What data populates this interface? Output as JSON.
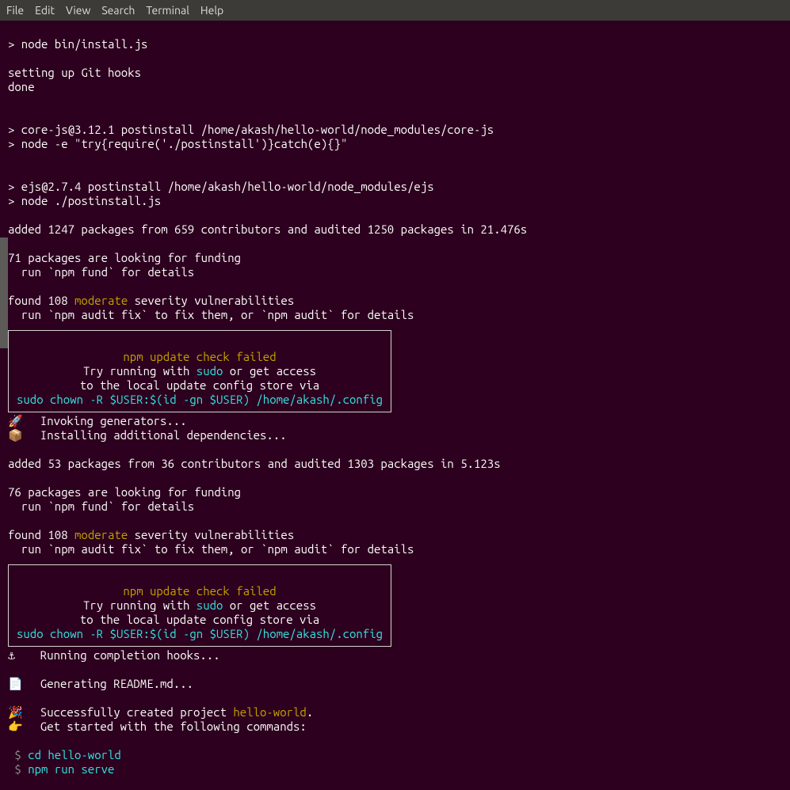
{
  "menu": {
    "file": "File",
    "edit": "Edit",
    "view": "View",
    "search": "Search",
    "terminal": "Terminal",
    "help": "Help"
  },
  "lines": {
    "l01": "> node bin/install.js",
    "l02": "",
    "l03": "setting up Git hooks",
    "l04": "done",
    "l05": "",
    "l06": "",
    "l07": "> core-js@3.12.1 postinstall /home/akash/hello-world/node_modules/core-js",
    "l08": "> node -e \"try{require('./postinstall')}catch(e){}\"",
    "l09": "",
    "l10": "",
    "l11": "> ejs@2.7.4 postinstall /home/akash/hello-world/node_modules/ejs",
    "l12": "> node ./postinstall.js",
    "l13": "",
    "l14": "added 1247 packages from 659 contributors and audited 1250 packages in 21.476s",
    "l15": "",
    "l16": "71 packages are looking for funding",
    "l17": "  run `npm fund` for details",
    "l18": "",
    "found1_a": "found 108 ",
    "found1_b": "moderate",
    "found1_c": " severity vulnerabilities",
    "l20": "  run `npm audit fix` to fix them, or `npm audit` for details",
    "box1_t1": "npm update check failed",
    "box1_t2a": "Try running with ",
    "box1_t2b": "sudo",
    "box1_t2c": " or get access",
    "box1_t3": "to the local update config store via",
    "box1_t4": "sudo chown -R $USER:$(id -gn $USER) /home/akash/.config",
    "rocket": "🚀",
    "invoking": "  Invoking generators...",
    "pkg": "📦",
    "installing": "  Installing additional dependencies...",
    "l25": "added 53 packages from 36 contributors and audited 1303 packages in 5.123s",
    "l26": "",
    "l27": "76 packages are looking for funding",
    "l28": "  run `npm fund` for details",
    "found2_a": "found 108 ",
    "found2_b": "moderate",
    "found2_c": " severity vulnerabilities",
    "l30": "  run `npm audit fix` to fix them, or `npm audit` for details",
    "anchor": "⚓",
    "hooks": "  Running completion hooks...",
    "doc": "📄",
    "readme": "  Generating README.md...",
    "party": "🎉",
    "success_a": "  Successfully created project ",
    "success_b": "hello-world",
    "success_c": ".",
    "point": "👉",
    "getstarted": "  Get started with the following commands:",
    "prompt": " $ ",
    "cmd1": "cd hello-world",
    "cmd2": "npm run serve"
  }
}
